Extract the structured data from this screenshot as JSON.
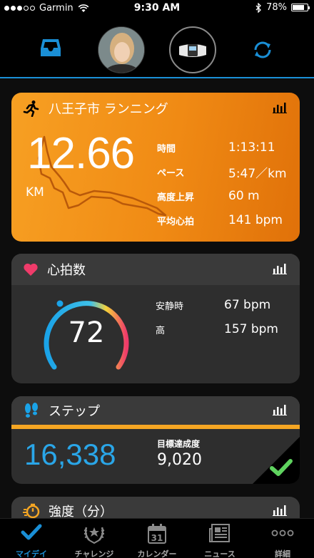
{
  "status": {
    "carrier": "Garmin",
    "time": "9:30 AM",
    "battery": "78%",
    "signal_bars_filled": 3
  },
  "nav": {
    "icons": [
      "inbox-icon",
      "profile-avatar",
      "device-avatar",
      "sync-icon"
    ],
    "accent": "#1a8fd6"
  },
  "run": {
    "title": "八王子市 ランニング",
    "distance": "12.66",
    "unit": "KM",
    "stats": [
      {
        "label": "時間",
        "value": "1:13:11"
      },
      {
        "label": "ペース",
        "value": "5:47／km"
      },
      {
        "label": "高度上昇",
        "value": "60 m"
      },
      {
        "label": "平均心拍",
        "value": "141 bpm"
      }
    ]
  },
  "heart": {
    "title": "心拍数",
    "current": "72",
    "stats": [
      {
        "label": "安静時",
        "value": "67 bpm"
      },
      {
        "label": "高",
        "value": "157 bpm"
      }
    ]
  },
  "steps": {
    "title": "ステップ",
    "count": "16,338",
    "goal_label": "目標達成度",
    "goal_value": "9,020",
    "goal_reached": true
  },
  "intensity": {
    "title": "強度（分）"
  },
  "tabs": [
    {
      "label": "マイデイ",
      "icon": "check-icon",
      "active": true
    },
    {
      "label": "チャレンジ",
      "icon": "laurel-icon",
      "active": false
    },
    {
      "label": "カレンダー",
      "icon": "calendar-icon",
      "active": false,
      "date": "31"
    },
    {
      "label": "ニュース",
      "icon": "news-icon",
      "active": false
    },
    {
      "label": "詳細",
      "icon": "more-icon",
      "active": false
    }
  ]
}
